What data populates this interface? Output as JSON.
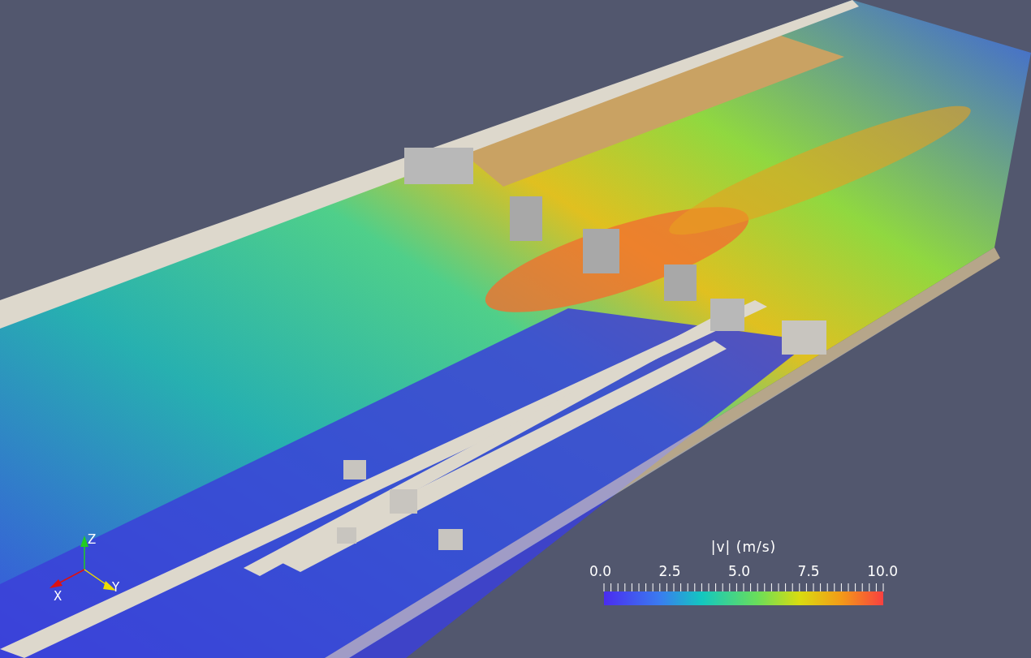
{
  "legend": {
    "title": "|v| (m/s)",
    "labels": [
      "0.0",
      "2.5",
      "5.0",
      "7.5",
      "10.0"
    ]
  },
  "axes": [
    {
      "kind": "z",
      "label": "Z"
    },
    {
      "kind": "x",
      "label": "X"
    },
    {
      "kind": "y",
      "label": "Y"
    }
  ]
}
